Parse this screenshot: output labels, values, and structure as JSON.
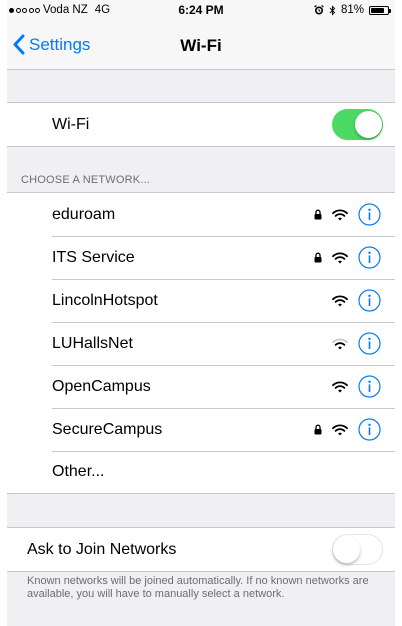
{
  "status_bar": {
    "carrier": "Voda NZ",
    "network": "4G",
    "time": "6:24 PM",
    "battery": "81%",
    "battery_level": 0.81
  },
  "nav": {
    "back_label": "Settings",
    "title": "Wi-Fi"
  },
  "wifi_toggle": {
    "label": "Wi-Fi",
    "on": true
  },
  "section_header": "CHOOSE A NETWORK...",
  "networks": [
    {
      "name": "eduroam",
      "locked": true,
      "signal": "full"
    },
    {
      "name": "ITS Service",
      "locked": true,
      "signal": "full"
    },
    {
      "name": "LincolnHotspot",
      "locked": false,
      "signal": "full"
    },
    {
      "name": "LUHallsNet",
      "locked": false,
      "signal": "medium"
    },
    {
      "name": "OpenCampus",
      "locked": false,
      "signal": "full"
    },
    {
      "name": "SecureCampus",
      "locked": true,
      "signal": "full"
    }
  ],
  "other_label": "Other...",
  "ask_to_join": {
    "label": "Ask to Join Networks",
    "on": false
  },
  "footer": "Known networks will be joined automatically. If no known networks are available, you will have to manually select a network.",
  "colors": {
    "accent": "#007aff",
    "toggle_on": "#4cd964",
    "background": "#efeff4"
  }
}
